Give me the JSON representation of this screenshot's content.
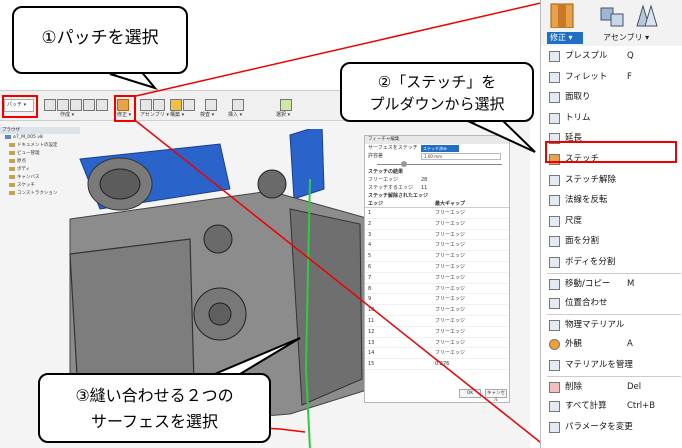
{
  "callouts": {
    "step1": "①パッチを選択",
    "step2_line1": "②「ステッチ」を",
    "step2_line2": "プルダウンから選択",
    "step3_line1": "③縫い合わせる２つの",
    "step3_line2": "サーフェスを選択"
  },
  "toolbar": {
    "workspace_tab": "パッチ ▾",
    "groups": [
      "作成 ▾",
      "修正 ▾",
      "アセンブリ ▾",
      "構築 ▾",
      "検査 ▾",
      "挿入 ▾",
      "選択 ▾"
    ]
  },
  "browser": {
    "header": "ブラウザ",
    "items": [
      "α7_M_005 v8",
      "ドキュメントの設定",
      "ビュー管理",
      "原点",
      "ボディ",
      "キャンバス",
      "スケッチ",
      "コンストラクション"
    ]
  },
  "dialog": {
    "title": "フィーチャ編集",
    "row_type_label": "サーフェスをステッチ",
    "tab_label": "ステッチ済み",
    "tolerance_label": "許容差",
    "tolerance_value": "1.00 mm",
    "section_result": "ステッチの結果",
    "free_edges_label": "フリーエッジ",
    "free_edges_value": "28",
    "stitched_edges_label": "ステッチするエッジ",
    "stitched_edges_value": "11",
    "section_unstitched": "ステッチ解除されたエッジ",
    "col_edge": "エッジ",
    "col_max_gap": "最大ギャップ",
    "rows": [
      {
        "edge": "1",
        "gap": "フリーエッジ"
      },
      {
        "edge": "2",
        "gap": "フリーエッジ"
      },
      {
        "edge": "3",
        "gap": "フリーエッジ"
      },
      {
        "edge": "4",
        "gap": "フリーエッジ"
      },
      {
        "edge": "5",
        "gap": "フリーエッジ"
      },
      {
        "edge": "6",
        "gap": "フリーエッジ"
      },
      {
        "edge": "7",
        "gap": "フリーエッジ"
      },
      {
        "edge": "8",
        "gap": "フリーエッジ"
      },
      {
        "edge": "9",
        "gap": "フリーエッジ"
      },
      {
        "edge": "10",
        "gap": "フリーエッジ"
      },
      {
        "edge": "11",
        "gap": "フリーエッジ"
      },
      {
        "edge": "12",
        "gap": "フリーエッジ"
      },
      {
        "edge": "13",
        "gap": "フリーエッジ"
      },
      {
        "edge": "14",
        "gap": "フリーエッジ"
      },
      {
        "edge": "15",
        "gap": "0.276"
      }
    ],
    "ok_label": "OK",
    "cancel_label": "キャンセル"
  },
  "menu": {
    "categories": {
      "active": "修正 ▾",
      "other": "アセンブリ ▾"
    },
    "items": [
      {
        "label": "プレスプル",
        "shortcut": "Q",
        "icon": "press-pull-icon"
      },
      {
        "label": "フィレット",
        "shortcut": "F",
        "icon": "fillet-icon"
      },
      {
        "label": "面取り",
        "shortcut": "",
        "icon": "chamfer-icon"
      },
      {
        "label": "トリム",
        "shortcut": "",
        "icon": "trim-icon"
      },
      {
        "label": "延長",
        "shortcut": "",
        "icon": "extend-icon"
      },
      {
        "label": "ステッチ",
        "shortcut": "",
        "icon": "stitch-icon"
      },
      {
        "label": "ステッチ解除",
        "shortcut": "",
        "icon": "unstitch-icon"
      },
      {
        "label": "法線を反転",
        "shortcut": "",
        "icon": "reverse-normal-icon"
      },
      {
        "label": "尺度",
        "shortcut": "",
        "icon": "scale-icon"
      },
      {
        "label": "面を分割",
        "shortcut": "",
        "icon": "split-face-icon"
      },
      {
        "label": "ボディを分割",
        "shortcut": "",
        "icon": "split-body-icon"
      },
      {
        "label": "移動/コピー",
        "shortcut": "M",
        "icon": "move-icon"
      },
      {
        "label": "位置合わせ",
        "shortcut": "",
        "icon": "align-icon"
      },
      {
        "label": "物理マテリアル",
        "shortcut": "",
        "icon": "physical-material-icon"
      },
      {
        "label": "外観",
        "shortcut": "A",
        "icon": "appearance-icon"
      },
      {
        "label": "マテリアルを管理",
        "shortcut": "",
        "icon": "manage-materials-icon"
      },
      {
        "label": "削除",
        "shortcut": "Del",
        "icon": "delete-icon"
      },
      {
        "label": "すべて計算",
        "shortcut": "Ctrl+B",
        "icon": "compute-all-icon"
      },
      {
        "label": "パラメータを変更",
        "shortcut": "",
        "icon": "change-parameters-icon"
      }
    ]
  },
  "colors": {
    "highlight_red": "#e00000",
    "accent_blue": "#1f6fc5",
    "surface_blue": "#2a63c9",
    "model_gray": "#8a8a8a"
  }
}
